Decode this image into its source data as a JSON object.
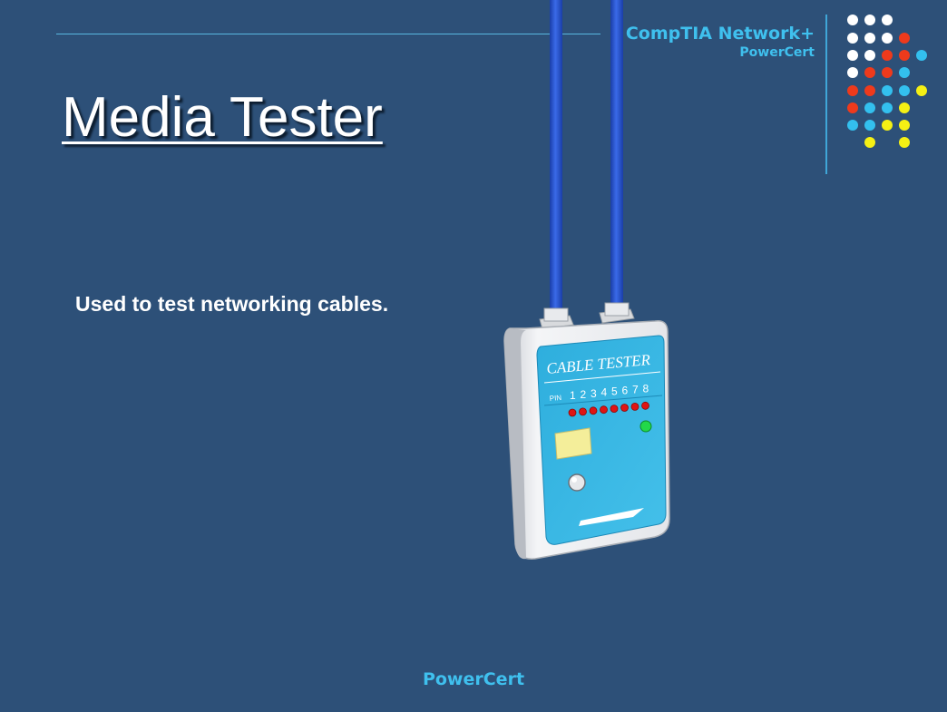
{
  "header": {
    "brand_title": "CompTIA Network+",
    "brand_sub": "PowerCert"
  },
  "slide": {
    "title": "Media Tester",
    "body": "Used to test networking cables."
  },
  "illustration": {
    "device_label": "CABLE TESTER",
    "pin_label": "PIN",
    "pins": [
      "1",
      "2",
      "3",
      "4",
      "5",
      "6",
      "7",
      "8"
    ]
  },
  "footer": {
    "text": "PowerCert"
  },
  "colors": {
    "background": "#2d5078",
    "accent": "#3fc0ee",
    "dot_white": "#ffffff",
    "dot_red": "#ee3a1c",
    "dot_blue": "#33c0ee",
    "dot_yellow": "#f5f014",
    "tester_body": "#36b4e2",
    "cable": "#2a55cc"
  }
}
